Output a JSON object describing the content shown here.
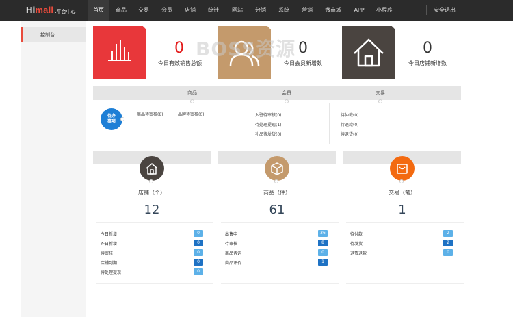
{
  "nav": {
    "logo_brand_part1": "Hi",
    "logo_brand_part2": "mall",
    "logo_sub": ".平台中心",
    "items": [
      "首页",
      "商品",
      "交易",
      "会员",
      "店铺",
      "统计",
      "网站",
      "分销",
      "系统",
      "营销",
      "微商城",
      "APP",
      "小程序"
    ],
    "logout": "安全退出"
  },
  "sidebar": {
    "item": "控制台"
  },
  "stats": [
    {
      "value": "0",
      "label": "今日有效销售总额",
      "icon": "bar-chart-icon",
      "color": "#e8373a"
    },
    {
      "value": "0",
      "label": "今日会员新增数",
      "icon": "users-icon",
      "color": "#c49a6c"
    },
    {
      "value": "0",
      "label": "今日店铺新增数",
      "icon": "home-icon",
      "color": "#4a4440"
    }
  ],
  "watermark": "BOSS资源",
  "pending": {
    "badge": "待办\n事项",
    "badge_l1": "待办",
    "badge_l2": "事项",
    "headers": [
      "商品",
      "会员",
      "交易"
    ],
    "goods": [
      "商品待审核(8)",
      "品牌待审核(0)"
    ],
    "members": [
      "入驻待审核(0)",
      "待处理提现(1)",
      "礼品待发货(0)"
    ],
    "trade": [
      "待仲裁(0)",
      "待退款(0)",
      "待退货(0)"
    ]
  },
  "panels": [
    {
      "title": "店铺（个）",
      "total": "12",
      "icon": "home-icon",
      "color": "#4a4440",
      "rows": [
        {
          "label": "今日新增",
          "value": "0"
        },
        {
          "label": "昨日新增",
          "value": "0"
        },
        {
          "label": "待审核",
          "value": "0"
        },
        {
          "label": "店铺到期",
          "value": "0"
        },
        {
          "label": "待处理提现",
          "value": "0"
        }
      ]
    },
    {
      "title": "商品（件）",
      "total": "61",
      "icon": "box-icon",
      "color": "#c49a6c",
      "rows": [
        {
          "label": "出售中",
          "value": "36"
        },
        {
          "label": "待审核",
          "value": "8"
        },
        {
          "label": "商品咨询",
          "value": "0"
        },
        {
          "label": "商品评价",
          "value": "1"
        }
      ]
    },
    {
      "title": "交易（笔）",
      "total": "1",
      "icon": "shopping-bag-icon",
      "color": "#f36a10",
      "rows": [
        {
          "label": "待付款",
          "value": "2"
        },
        {
          "label": "待发货",
          "value": "2"
        },
        {
          "label": "退货退款",
          "value": "0"
        }
      ]
    }
  ]
}
